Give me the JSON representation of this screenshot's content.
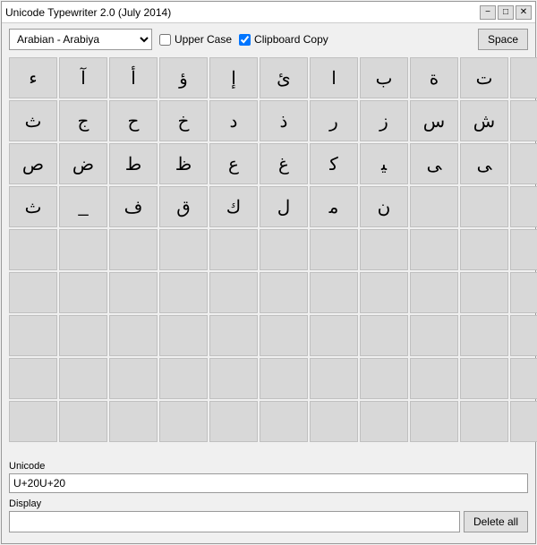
{
  "window": {
    "title": "Unicode Typewriter 2.0 (July 2014)",
    "controls": {
      "minimize": "−",
      "maximize": "□",
      "close": "✕"
    }
  },
  "toolbar": {
    "dropdown_value": "Arabian      - Arabiya",
    "uppercase_label": "Upper Case",
    "clipboard_label": "Clipboard Copy",
    "space_label": "Space",
    "uppercase_checked": false,
    "clipboard_checked": true
  },
  "grid": {
    "rows": [
      [
        "ء",
        "آ",
        "أ",
        "ؤ",
        "إ",
        "ئ",
        "ا",
        "ب",
        "ة",
        "ت",
        ""
      ],
      [
        "ث",
        "ج",
        "ح",
        "خ",
        "د",
        "ذ",
        "ر",
        "ز",
        "س",
        "ش",
        ""
      ],
      [
        "ص",
        "ض",
        "ط",
        "ظ",
        "ع",
        "غ",
        "ﻛ",
        "ﻴ",
        "ﻰ",
        "ﻰ",
        ""
      ],
      [
        "ﺙ",
        "_",
        "ف",
        "ق",
        "ك",
        "ل",
        "ﻣ",
        "ن",
        "",
        "",
        ""
      ],
      [
        "",
        "",
        "",
        "",
        "",
        "",
        "",
        "",
        "",
        "",
        ""
      ],
      [
        "",
        "",
        "",
        "",
        "",
        "",
        "",
        "",
        "",
        "",
        ""
      ],
      [
        "",
        "",
        "",
        "",
        "",
        "",
        "",
        "",
        "",
        "",
        ""
      ],
      [
        "",
        "",
        "",
        "",
        "",
        "",
        "",
        "",
        "",
        "",
        ""
      ],
      [
        "",
        "",
        "",
        "",
        "",
        "",
        "",
        "",
        "",
        "",
        ""
      ]
    ]
  },
  "unicode_field": {
    "label": "Unicode",
    "value": "U+20U+20"
  },
  "display_field": {
    "label": "Display",
    "value": "",
    "delete_label": "Delete all"
  }
}
